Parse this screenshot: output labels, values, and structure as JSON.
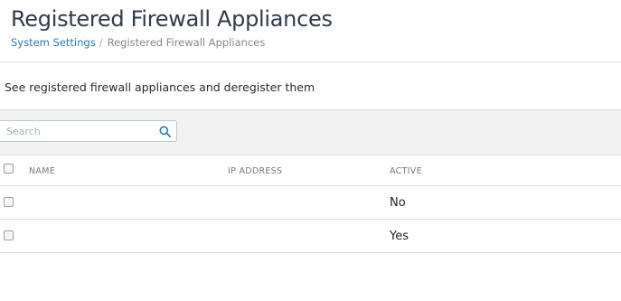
{
  "header": {
    "title": "Registered Firewall Appliances",
    "breadcrumb": {
      "parent": "System Settings",
      "separator": "/",
      "current": "Registered Firewall Appliances"
    }
  },
  "description": "See registered firewall appliances and deregister them",
  "search": {
    "placeholder": "Search",
    "icon": "search-icon"
  },
  "table": {
    "columns": [
      "NAME",
      "IP ADDRESS",
      "ACTIVE"
    ],
    "rows": [
      {
        "name": "",
        "ip": "",
        "active": "No"
      },
      {
        "name": "",
        "ip": "",
        "active": "Yes"
      }
    ]
  },
  "colors": {
    "link": "#2a7ab8",
    "title": "#2f3b4a",
    "toolbar_bg": "#f2f2f2"
  }
}
